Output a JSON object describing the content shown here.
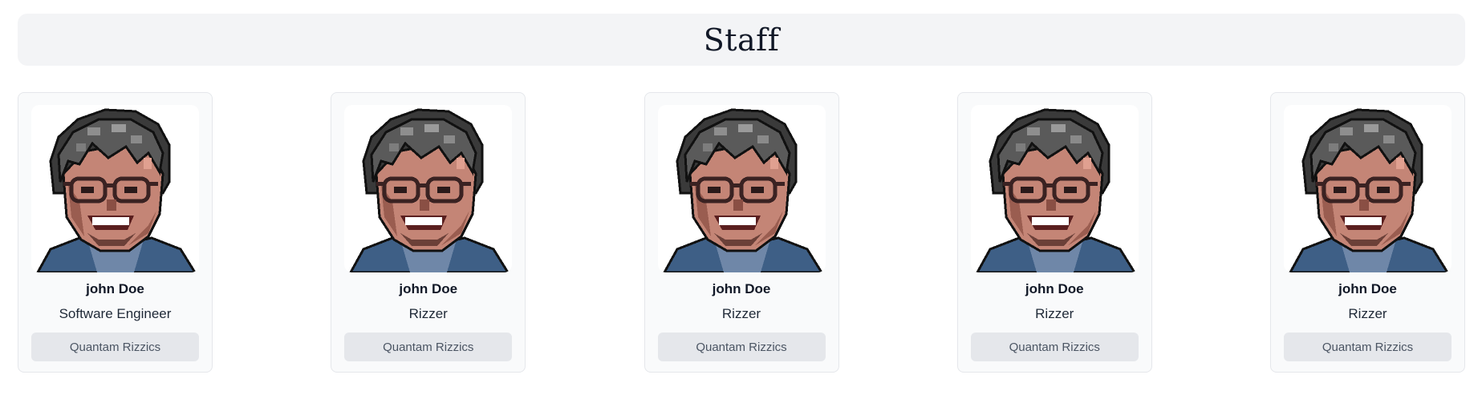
{
  "header": {
    "title": "Staff"
  },
  "staff": [
    {
      "name": "john Doe",
      "role": "Software Engineer",
      "company": "Quantam Rizzics"
    },
    {
      "name": "john Doe",
      "role": "Rizzer",
      "company": "Quantam Rizzics"
    },
    {
      "name": "john Doe",
      "role": "Rizzer",
      "company": "Quantam Rizzics"
    },
    {
      "name": "john Doe",
      "role": "Rizzer",
      "company": "Quantam Rizzics"
    },
    {
      "name": "john Doe",
      "role": "Rizzer",
      "company": "Quantam Rizzics"
    }
  ],
  "colors": {
    "header_bg": "#f3f4f6",
    "card_bg": "#f9fafb",
    "card_border": "#e5e7eb",
    "button_bg": "#e5e7eb",
    "button_text": "#4b5563"
  },
  "avatar_icon": "pixel-art-portrait"
}
